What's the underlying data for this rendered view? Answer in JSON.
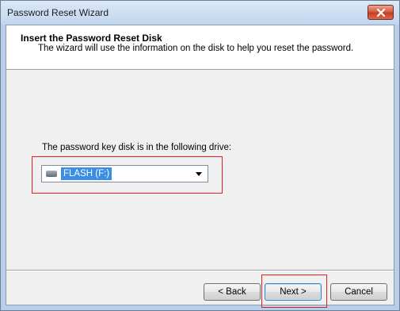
{
  "window": {
    "title": "Password Reset Wizard",
    "close_icon": "close-icon"
  },
  "header": {
    "title": "Insert the Password Reset Disk",
    "subtitle": "The wizard will use the information on the disk to help you reset the password."
  },
  "main": {
    "drive_label": "The password key disk is in the following drive:",
    "drive_select": {
      "selected": "FLASH (F:)",
      "icon": "usb-drive-icon"
    }
  },
  "buttons": {
    "back": "< Back",
    "next": "Next >",
    "cancel": "Cancel"
  },
  "colors": {
    "highlight_box": "#e02020",
    "selection": "#3a8ee6"
  }
}
